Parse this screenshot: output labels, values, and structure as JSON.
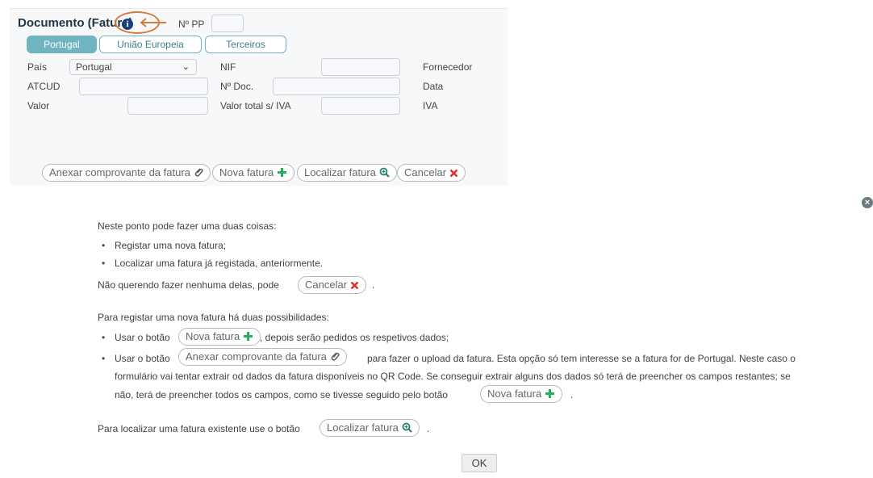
{
  "form": {
    "title": "Documento (Fatura)",
    "npp_label": "Nº PP",
    "npp_value": "",
    "tabs": [
      {
        "label": "Portugal",
        "active": true
      },
      {
        "label": "União Europeia",
        "active": false
      },
      {
        "label": "Terceiros",
        "active": false
      }
    ],
    "fields": {
      "pais_label": "País",
      "pais_value": "Portugal",
      "nif_label": "NIF",
      "fornecedor_label": "Fornecedor",
      "atcud_label": "ATCUD",
      "ndoc_label": "Nº Doc.",
      "data_label": "Data",
      "valor_label": "Valor",
      "valor_total_label": "Valor total s/ IVA",
      "iva_label": "IVA"
    },
    "actions": {
      "attach": "Anexar comprovante da fatura",
      "new": "Nova fatura",
      "find": "Localizar fatura",
      "cancel": "Cancelar"
    }
  },
  "help": {
    "intro": "Neste ponto pode fazer uma duas coisas:",
    "bullet1": "Registar uma nova fatura;",
    "bullet2": "Localizar uma fatura já registada, anteriormente.",
    "cancel_line": "Não querendo fazer nenhuma delas, pode",
    "cancel_btn": "Cancelar",
    "dot": ".",
    "register_intro": "Para registar uma nova fatura há duas possibilidades:",
    "use_button": "Usar o botão",
    "use_button2": "Usar o botão",
    "nova_btn": "Nova fatura",
    "after_nova": ", depois serão pedidos os respetivos dados;",
    "anexar_btn": "Anexar comprovante da fatura",
    "after_anexar": "para fazer o upload da fatura. Esta opção só tem interesse se a fatura for de Portugal. Neste caso o",
    "line_b": "formulário vai tentar extrair od dados da fatura disponíveis no QR Code. Se conseguir extrair alguns dos dados só terá de preencher os campos restantes; se",
    "line_c": "não, terá de preencher todos os campos, como se tivesse seguido pelo botão",
    "nova_btn2": "Nova fatura",
    "dot2": ".",
    "find_line": "Para localizar uma fatura existente use o botão",
    "find_btn": "Localizar fatura",
    "dot3": ".",
    "ok": "OK"
  },
  "colors": {
    "accent_teal": "#6fb4c0",
    "add_green": "#27ae60",
    "cancel_red": "#d9342b",
    "annotation_orange": "#d57a3a"
  }
}
